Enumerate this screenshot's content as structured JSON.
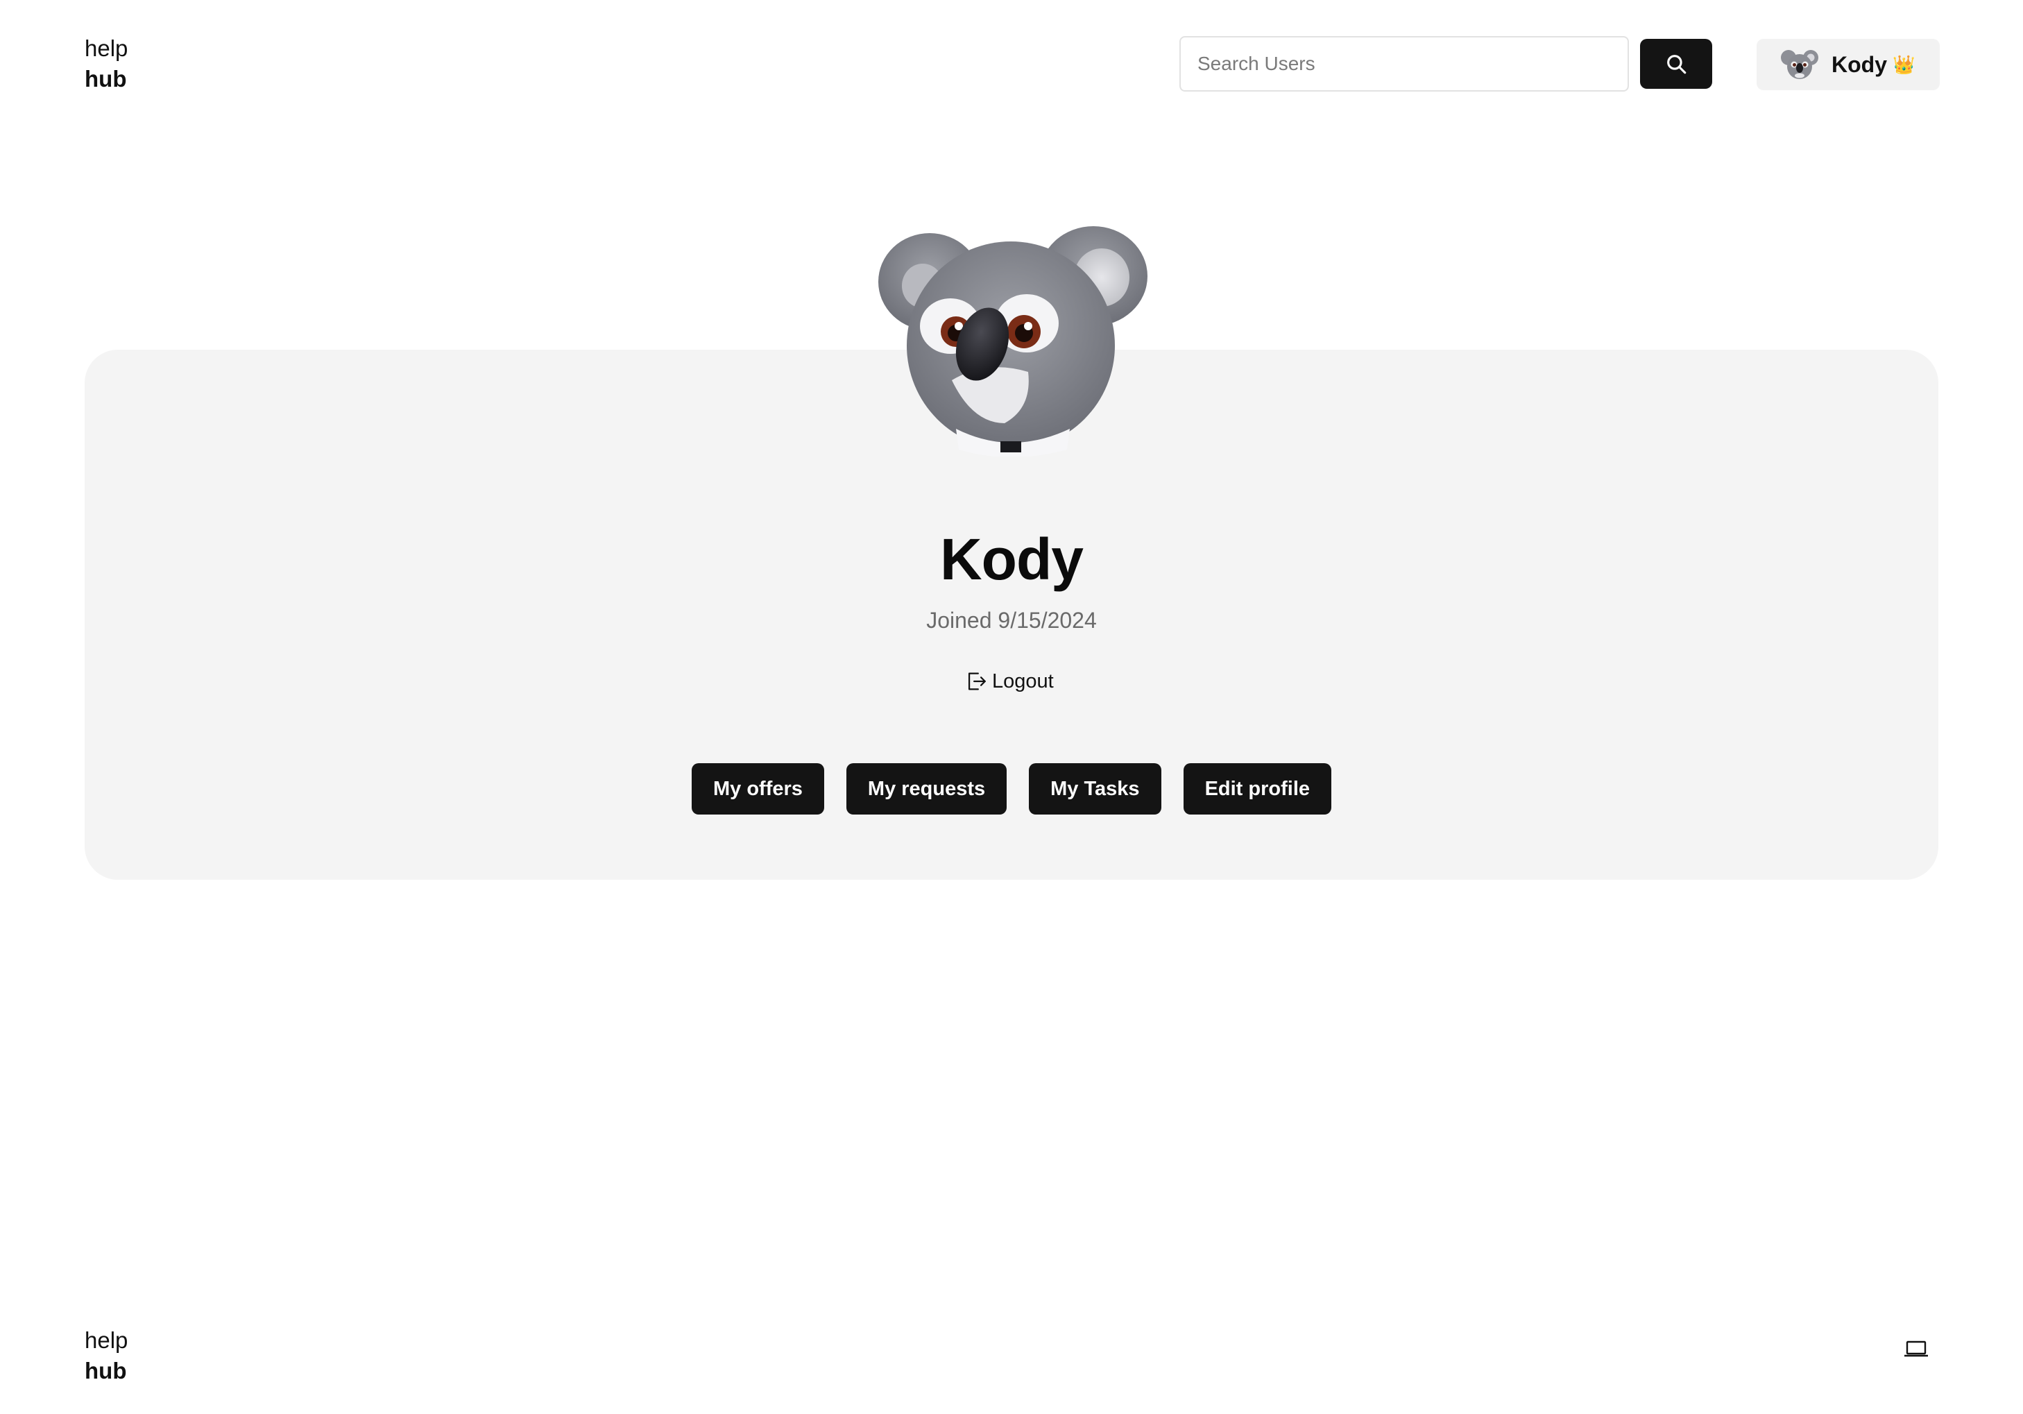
{
  "header": {
    "logo": {
      "line1": "help",
      "line2": "hub"
    },
    "search": {
      "placeholder": "Search Users",
      "button_icon": "search-icon"
    },
    "user_chip": {
      "name": "Kody",
      "badge": "👑",
      "avatar": "koala-avatar"
    }
  },
  "profile": {
    "avatar": "koala-avatar",
    "name": "Kody",
    "joined": "Joined 9/15/2024",
    "logout_label": "Logout",
    "logout_icon": "logout-icon",
    "actions": [
      "My offers",
      "My requests",
      "My Tasks",
      "Edit profile"
    ]
  },
  "footer": {
    "logo": {
      "line1": "help",
      "line2": "hub"
    },
    "theme_icon": "laptop-icon"
  },
  "colors": {
    "background": "#ffffff",
    "card": "#f4f4f4",
    "button": "#141414",
    "button_text": "#ffffff",
    "muted_text": "#6a6a6a"
  }
}
